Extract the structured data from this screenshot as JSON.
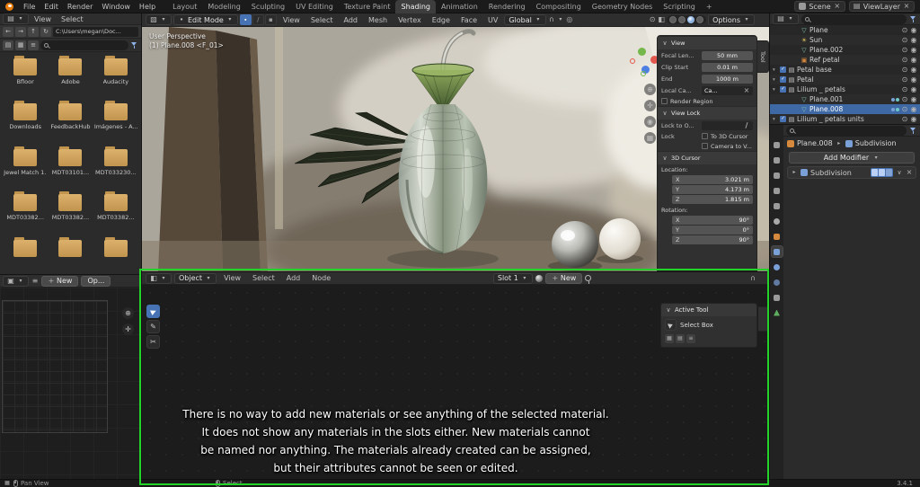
{
  "topbar": {
    "app_menus": [
      "File",
      "Edit",
      "Render",
      "Window",
      "Help"
    ],
    "workspaces": [
      {
        "label": "Layout"
      },
      {
        "label": "Modeling"
      },
      {
        "label": "Sculpting"
      },
      {
        "label": "UV Editing"
      },
      {
        "label": "Texture Paint"
      },
      {
        "label": "Shading",
        "active": true
      },
      {
        "label": "Animation"
      },
      {
        "label": "Rendering"
      },
      {
        "label": "Compositing"
      },
      {
        "label": "Geometry Nodes"
      },
      {
        "label": "Scripting"
      }
    ],
    "add_workspace": "+",
    "scene": "Scene",
    "view_layer": "ViewLayer"
  },
  "viewport": {
    "header": {
      "mode": "Edit Mode",
      "menus": [
        "View",
        "Select",
        "Add",
        "Mesh",
        "Vertex",
        "Edge",
        "Face",
        "UV"
      ],
      "orientation": "Global",
      "options": "Options"
    },
    "overlay": {
      "perspective": "User Perspective",
      "object_info": "(1) Plane.008 <F_01>"
    },
    "sidebar_tab": "Tool",
    "sidebar": {
      "view": {
        "title": "View",
        "focal_label": "Focal Len...",
        "focal_value": "50 mm",
        "clip_start_label": "Clip Start",
        "clip_start_value": "0.01 m",
        "end_label": "End",
        "end_value": "1000 m",
        "local_camera_label": "Local Ca...",
        "local_camera_value": "Ca...",
        "render_region_label": "Render Region"
      },
      "view_lock": {
        "title": "View Lock",
        "lock_to_object_label": "Lock to O...",
        "lock_label": "Lock",
        "to_3d_cursor_label": "To 3D Cursor",
        "camera_to_view_label": "Camera to V..."
      },
      "cursor": {
        "title": "3D Cursor",
        "location_label": "Location:",
        "x_label": "X",
        "x_value": "3.021 m",
        "y_label": "Y",
        "y_value": "4.173 m",
        "z_label": "Z",
        "z_value": "1.815 m",
        "rotation_label": "Rotation:",
        "rx_value": "90°",
        "ry_value": "0°",
        "rz_value": "90°"
      }
    }
  },
  "file_browser": {
    "menus": [
      "View",
      "Select"
    ],
    "path": "C:\\Users\\megan\\Doc...",
    "folders": [
      {
        "label": "Bfloor"
      },
      {
        "label": "Adobe"
      },
      {
        "label": "Audacity"
      },
      {
        "label": "Downloads"
      },
      {
        "label": "FeedbackHub"
      },
      {
        "label": "Imágenes - A..."
      },
      {
        "label": "Jewel Match 1..."
      },
      {
        "label": "MDT03101..."
      },
      {
        "label": "MDT033230..."
      },
      {
        "label": "MDT03382..."
      },
      {
        "label": "MDT03382..."
      },
      {
        "label": "MDT03382..."
      },
      {
        "label": ""
      },
      {
        "label": ""
      },
      {
        "label": ""
      }
    ]
  },
  "image_editor": {
    "new_button": "New",
    "open_button": "Op..."
  },
  "outliner": {
    "items": [
      {
        "label": "Plane",
        "icon": "mesh",
        "depth": 1
      },
      {
        "label": "Sun",
        "icon": "light",
        "depth": 1
      },
      {
        "label": "Plane.002",
        "icon": "mesh",
        "depth": 1
      },
      {
        "label": "Ref petal",
        "icon": "image",
        "depth": 1
      },
      {
        "label": "Petal base",
        "icon": "collection",
        "depth": 0,
        "arrow": true,
        "checkbox": true
      },
      {
        "label": "Petal",
        "icon": "collection",
        "depth": 0,
        "arrow": true,
        "checkbox": true
      },
      {
        "label": "Lilium _ petals",
        "icon": "collection",
        "depth": 0,
        "arrow": true,
        "checkbox": true
      },
      {
        "label": "Plane.001",
        "icon": "mesh",
        "depth": 1,
        "badges": true
      },
      {
        "label": "Plane.008",
        "icon": "mesh",
        "depth": 1,
        "badges": true,
        "selected": true
      },
      {
        "label": "Lilium _ petals units",
        "icon": "collection",
        "depth": 0,
        "arrow": true,
        "checkbox": true
      }
    ]
  },
  "properties": {
    "tabs": [
      {
        "icon": "tool"
      },
      {
        "icon": "render"
      },
      {
        "icon": "output"
      },
      {
        "icon": "view-layer"
      },
      {
        "icon": "scene"
      },
      {
        "icon": "world"
      },
      {
        "icon": "object"
      },
      {
        "icon": "modifiers",
        "active": true
      },
      {
        "icon": "particles"
      },
      {
        "icon": "physics"
      },
      {
        "icon": "constraints"
      },
      {
        "icon": "object-data"
      }
    ],
    "breadcrumb": {
      "object": "Plane.008",
      "modifier": "Subdivision"
    },
    "add_modifier": "Add Modifier",
    "modifier_name": "Subdivision"
  },
  "shader_editor": {
    "shader_type": "Object",
    "menus": [
      "View",
      "Select",
      "Add",
      "Node"
    ],
    "slot": "Slot 1",
    "new_button": "New",
    "overlay_lines": [
      "There is no way to add new materials or see anything of the selected material.",
      "It does not show any materials in the slots either. New materials cannot",
      "be named nor anything. The materials already created can be assigned,",
      "but their attributes cannot be seen or edited."
    ],
    "active_tool": {
      "title": "Active Tool",
      "tool_name": "Select Box"
    }
  },
  "statusbar": {
    "left": "Pan View",
    "middle": "Select",
    "version": "3.4.1"
  },
  "colors": {
    "accent": "#4772b3",
    "annotation_green": "#24d32a",
    "folder_tan": "#d0a055"
  },
  "icons": [
    "search-icon",
    "filter-icon",
    "back-icon",
    "forward-icon",
    "up-icon",
    "refresh-icon",
    "zoom-icon",
    "pan-hand-icon",
    "camera-view-icon",
    "grid-view-icon",
    "navigation-gizmo",
    "magnet-snap-icon",
    "proportional-editing-icon",
    "eye-icon",
    "render-visibility-icon",
    "pin-icon",
    "select-box-tool-icon",
    "annotate-tool-icon",
    "links-cut-tool-icon",
    "eyedropper-icon"
  ]
}
